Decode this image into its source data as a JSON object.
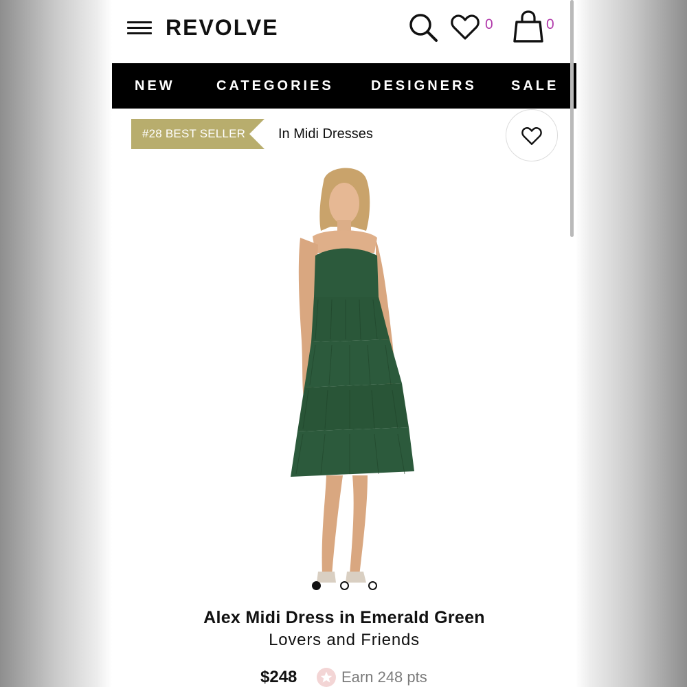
{
  "header": {
    "logo": "REVOLVE",
    "wishlist_count": "0",
    "bag_count": "0"
  },
  "nav": {
    "items": [
      {
        "label": "NEW"
      },
      {
        "label": "CATEGORIES"
      },
      {
        "label": "DESIGNERS"
      },
      {
        "label": "SALE"
      }
    ]
  },
  "badge": {
    "text": "#28 BEST SELLER",
    "category": "In Midi Dresses",
    "color": "#b8ad6d"
  },
  "carousel": {
    "total": 3,
    "active_index": 0
  },
  "product": {
    "name": "Alex Midi Dress in Emerald Green",
    "brand": "Lovers and Friends",
    "price": "$248",
    "points": "Earn 248 pts",
    "dress_color": "#2c5a3c"
  },
  "colors": {
    "accent_count": "#b23bab",
    "nav_bg": "#000000"
  },
  "icons": [
    "menu-icon",
    "search-icon",
    "heart-icon",
    "bag-icon",
    "star-icon"
  ]
}
